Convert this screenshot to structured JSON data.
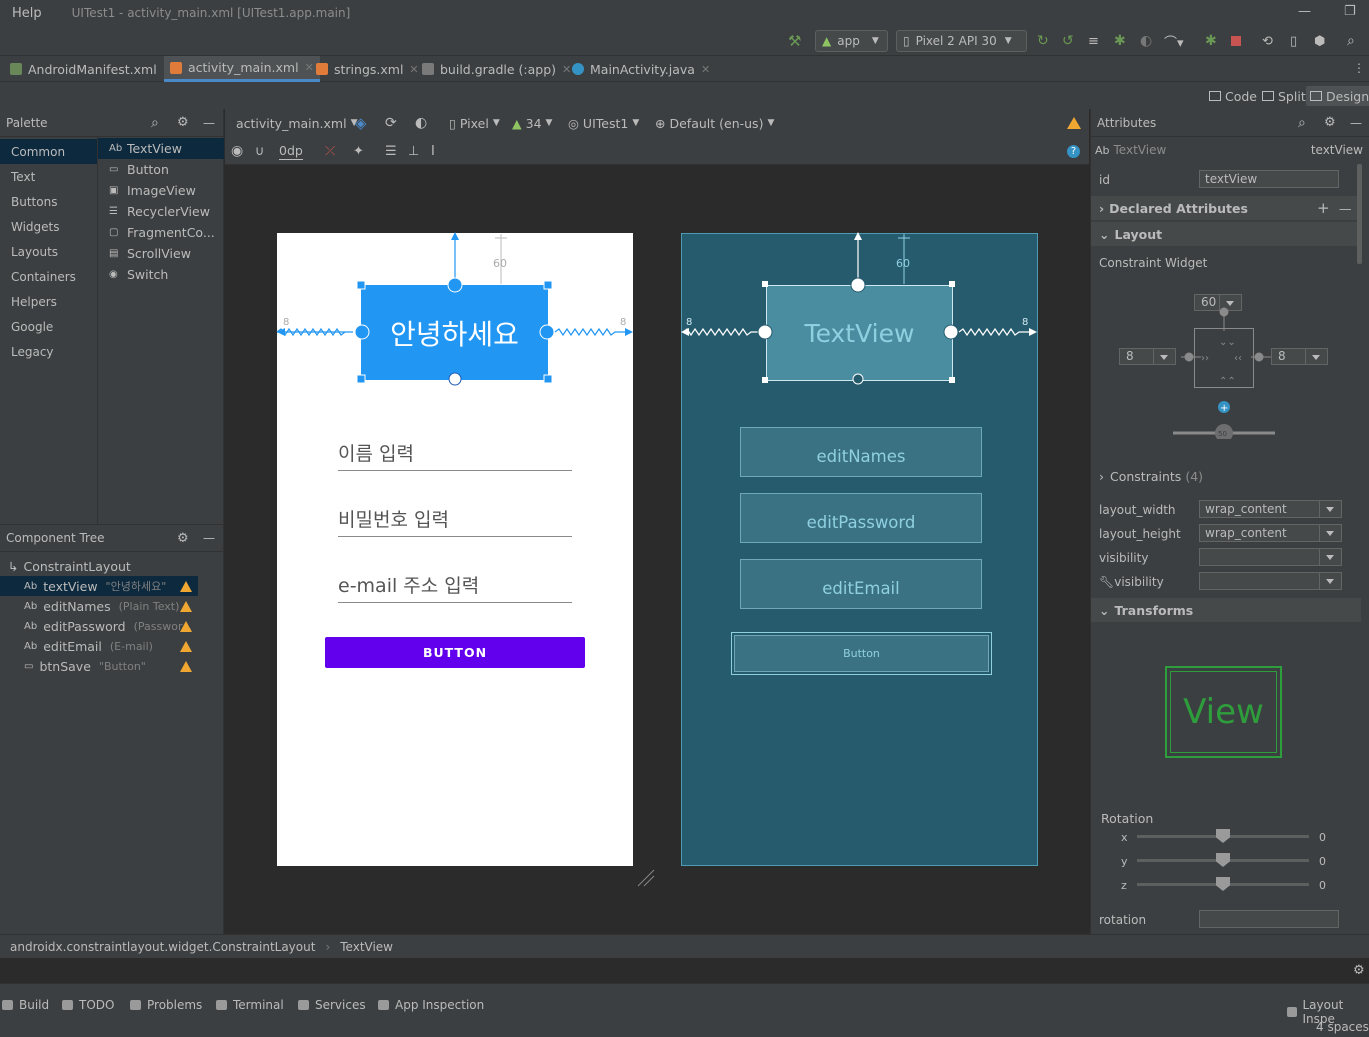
{
  "window": {
    "menu_help": "Help",
    "title": "UITest1 - activity_main.xml [UITest1.app.main]"
  },
  "toolbar": {
    "module": "app",
    "device": "Pixel 2 API 30"
  },
  "tabs": [
    {
      "label": "AndroidManifest.xml",
      "color": "#6a8759"
    },
    {
      "label": "activity_main.xml",
      "color": "#e07b39"
    },
    {
      "label": "strings.xml",
      "color": "#e07b39"
    },
    {
      "label": "build.gradle (:app)",
      "color": "#7a7a7a"
    },
    {
      "label": "MainActivity.java",
      "color": "#3592c4"
    }
  ],
  "view_modes": {
    "code": "Code",
    "split": "Split",
    "design": "Design"
  },
  "palette": {
    "title": "Palette",
    "categories": [
      "Common",
      "Text",
      "Buttons",
      "Widgets",
      "Layouts",
      "Containers",
      "Helpers",
      "Google",
      "Legacy"
    ],
    "items": [
      "TextView",
      "Button",
      "ImageView",
      "RecyclerView",
      "FragmentCo...",
      "ScrollView",
      "Switch"
    ]
  },
  "component_tree": {
    "title": "Component Tree",
    "root": "ConstraintLayout",
    "items": [
      {
        "name": "textView",
        "detail": "\"안녕하세요\""
      },
      {
        "name": "editNames",
        "detail": "(Plain Text)"
      },
      {
        "name": "editPassword",
        "detail": "(Passwor..."
      },
      {
        "name": "editEmail",
        "detail": "(E-mail)"
      },
      {
        "name": "btnSave",
        "detail": "\"Button\""
      }
    ]
  },
  "design_toolbar": {
    "file": "activity_main.xml",
    "device": "Pixel",
    "api": "34",
    "theme": "UITest1",
    "locale": "Default (en-us)",
    "margin": "0dp"
  },
  "design": {
    "textview_text": "안녕하세요",
    "margin_top": "60",
    "margin_side": "8",
    "edit_names_hint": "이름 입력",
    "edit_password_hint": "비밀번호 입력",
    "edit_email_hint": "e-mail 주소 입력",
    "button_label": "BUTTON",
    "accent": "#2196f3",
    "button_color": "#6200ee"
  },
  "blueprint": {
    "textview": "TextView",
    "edit_names": "editNames",
    "edit_password": "editPassword",
    "edit_email": "editEmail",
    "button": "Button",
    "margin_top": "60",
    "margin_side": "8"
  },
  "attributes": {
    "title": "Attributes",
    "widget_type": "TextView",
    "widget_id": "textView",
    "id_label": "id",
    "id_value": "textView",
    "declared": "Declared Attributes",
    "layout": "Layout",
    "constraint_widget": "Constraint Widget",
    "margin_top": "60",
    "margin_left": "8",
    "margin_right": "8",
    "bias": "50",
    "constraints": "Constraints",
    "constraints_count": "(4)",
    "layout_width_label": "layout_width",
    "layout_width": "wrap_content",
    "layout_height_label": "layout_height",
    "layout_height": "wrap_content",
    "visibility_label": "visibility",
    "tools_visibility_label": "visibility",
    "transforms": "Transforms",
    "view_preview": "View",
    "rotation_label": "Rotation",
    "rot_x": "x",
    "rot_y": "y",
    "rot_z": "z",
    "rot_x_val": "0",
    "rot_y_val": "0",
    "rot_z_val": "0",
    "rotation_field": "rotation"
  },
  "breadcrumb": {
    "parent": "androidx.constraintlayout.widget.ConstraintLayout",
    "child": "TextView"
  },
  "bottom_tools": [
    "Build",
    "TODO",
    "Problems",
    "Terminal",
    "Services",
    "App Inspection"
  ],
  "bottom_right": {
    "layout_inspector": "Layout Inspe",
    "indent": "4 spaces"
  }
}
